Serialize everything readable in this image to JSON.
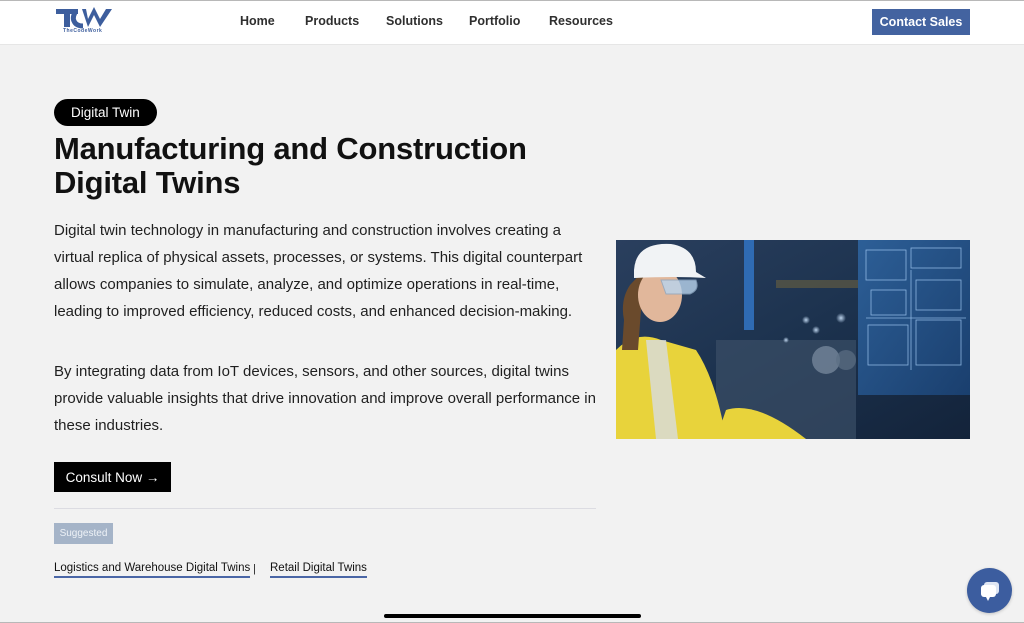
{
  "header": {
    "logo_text": "TCW",
    "logo_subtext": "TheCodeWork",
    "nav": [
      {
        "label": "Home"
      },
      {
        "label": "Products"
      },
      {
        "label": "Solutions"
      },
      {
        "label": "Portfolio"
      },
      {
        "label": "Resources"
      }
    ],
    "contact_label": "Contact Sales"
  },
  "hero": {
    "tag": "Digital Twin",
    "title": "Manufacturing and Construction Digital Twins",
    "paragraphs": [
      "Digital twin technology in manufacturing and construction involves creating a virtual replica of physical assets, processes, or systems. This digital counterpart allows companies to simulate, analyze, and optimize operations in real-time, leading to improved efficiency, reduced costs, and enhanced decision-making.",
      "By integrating data from IoT devices, sensors, and other sources, digital twins provide valuable insights that drive innovation and improve overall performance in these industries."
    ],
    "cta_label": "Consult Now →",
    "image_alt": "Engineer in hard hat and safety glasses viewing a digital twin dashboard in a factory"
  },
  "suggested": {
    "label": "Suggested",
    "separator": "|",
    "links": [
      {
        "label": "Logistics and Warehouse Digital Twins"
      },
      {
        "label": "Retail Digital Twins"
      }
    ]
  },
  "colors": {
    "brand": "#4363a0",
    "background": "#f2f2f2",
    "suggested_badge": "#a5b4c8",
    "link_underline": "#4a66a6"
  },
  "icons": {
    "chat": "chat-bubble-icon",
    "arrow": "arrow-right-icon"
  }
}
